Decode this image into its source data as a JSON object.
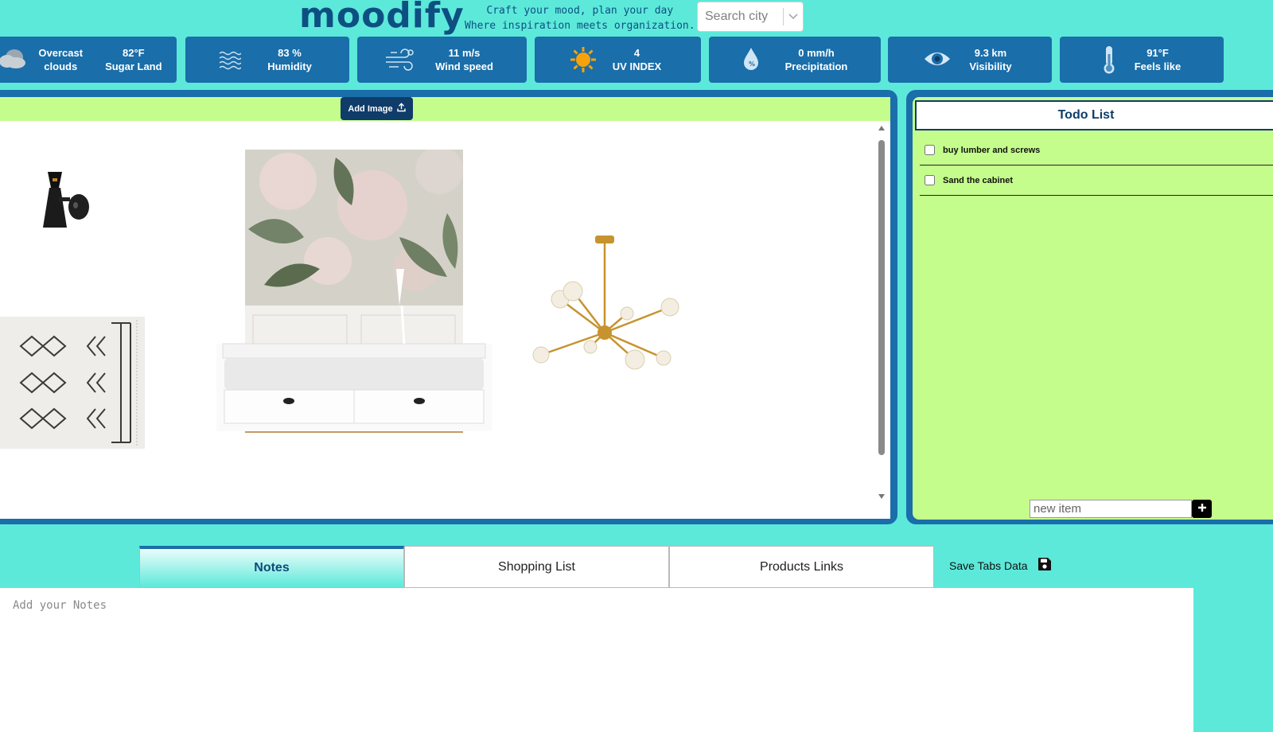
{
  "header": {
    "brand": "moodify",
    "tagline_line1": "Craft your mood, plan your day",
    "tagline_line2": "Where inspiration meets organization.",
    "search_placeholder": "Search city"
  },
  "weather": {
    "condition_line1": "Overcast",
    "condition_line2": "clouds",
    "temp": "82°F",
    "city": "Sugar Land",
    "humidity_value": "83 %",
    "humidity_label": "Humidity",
    "wind_value": "11 m/s",
    "wind_label": "Wind speed",
    "uv_value": "4",
    "uv_label": "UV INDEX",
    "precip_value": "0 mm/h",
    "precip_label": "Precipitation",
    "visibility_value": "9.3 km",
    "visibility_label": "Visibility",
    "feels_value": "91°F",
    "feels_label": "Feels like"
  },
  "board": {
    "add_image_label": "Add Image"
  },
  "todo": {
    "title": "Todo List",
    "items": [
      {
        "label": "buy lumber and screws",
        "checked": false
      },
      {
        "label": "Sand the cabinet",
        "checked": false
      }
    ],
    "new_item_placeholder": "new item"
  },
  "tabs": {
    "items": [
      "Notes",
      "Shopping List",
      "Products Links"
    ],
    "active": "Notes",
    "save_label": "Save Tabs Data",
    "notes_placeholder": "Add your Notes"
  },
  "colors": {
    "background": "#5ce9da",
    "panel": "#1a6ea9",
    "accent_green": "#c5fd8c",
    "dark_blue": "#0f3c69"
  }
}
